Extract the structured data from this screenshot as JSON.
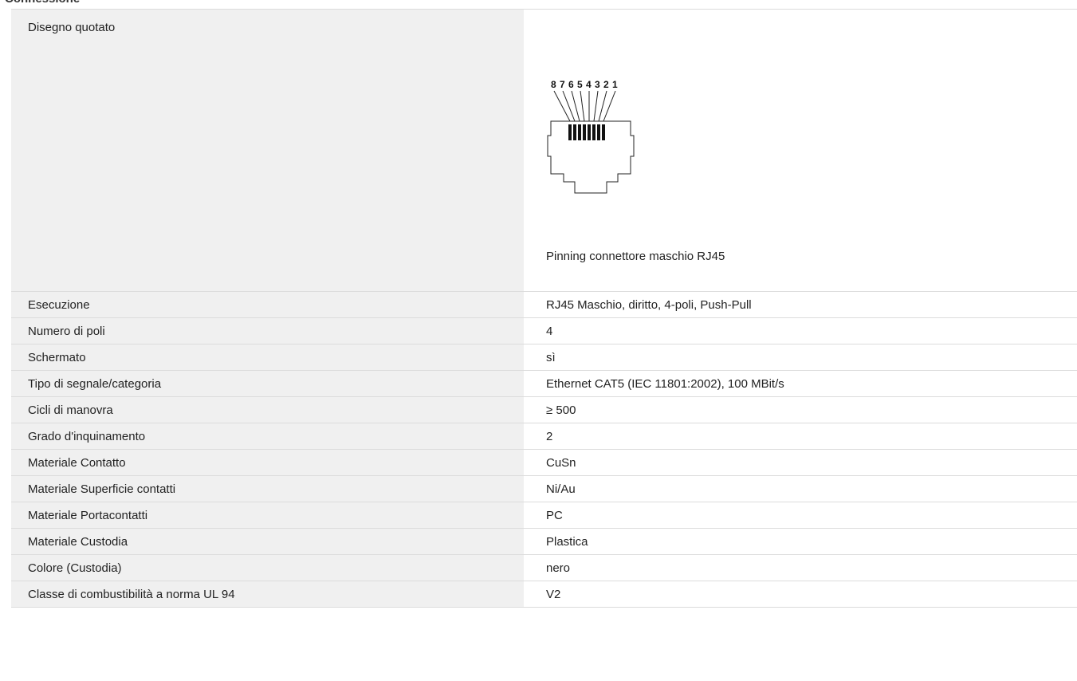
{
  "section_title": "Connessione",
  "drawing": {
    "label": "Disegno quotato",
    "pin_numbers": [
      "8",
      "7",
      "6",
      "5",
      "4",
      "3",
      "2",
      "1"
    ],
    "caption": "Pinning connettore maschio RJ45"
  },
  "rows": [
    {
      "label": "Esecuzione",
      "value": "RJ45 Maschio, diritto, 4-poli, Push-Pull"
    },
    {
      "label": "Numero di poli",
      "value": "4"
    },
    {
      "label": "Schermato",
      "value": "sì"
    },
    {
      "label": "Tipo di segnale/categoria",
      "value": "Ethernet CAT5 (IEC 11801:2002), 100 MBit/s"
    },
    {
      "label": "Cicli di manovra",
      "value": "≥ 500"
    },
    {
      "label": "Grado d'inquinamento",
      "value": "2"
    },
    {
      "label": "Materiale Contatto",
      "value": "CuSn"
    },
    {
      "label": "Materiale Superficie contatti",
      "value": "Ni/Au"
    },
    {
      "label": "Materiale Portacontatti",
      "value": "PC"
    },
    {
      "label": "Materiale Custodia",
      "value": "Plastica"
    },
    {
      "label": "Colore (Custodia)",
      "value": "nero"
    },
    {
      "label": "Classe di combustibilità a norma UL 94",
      "value": "V2"
    }
  ]
}
